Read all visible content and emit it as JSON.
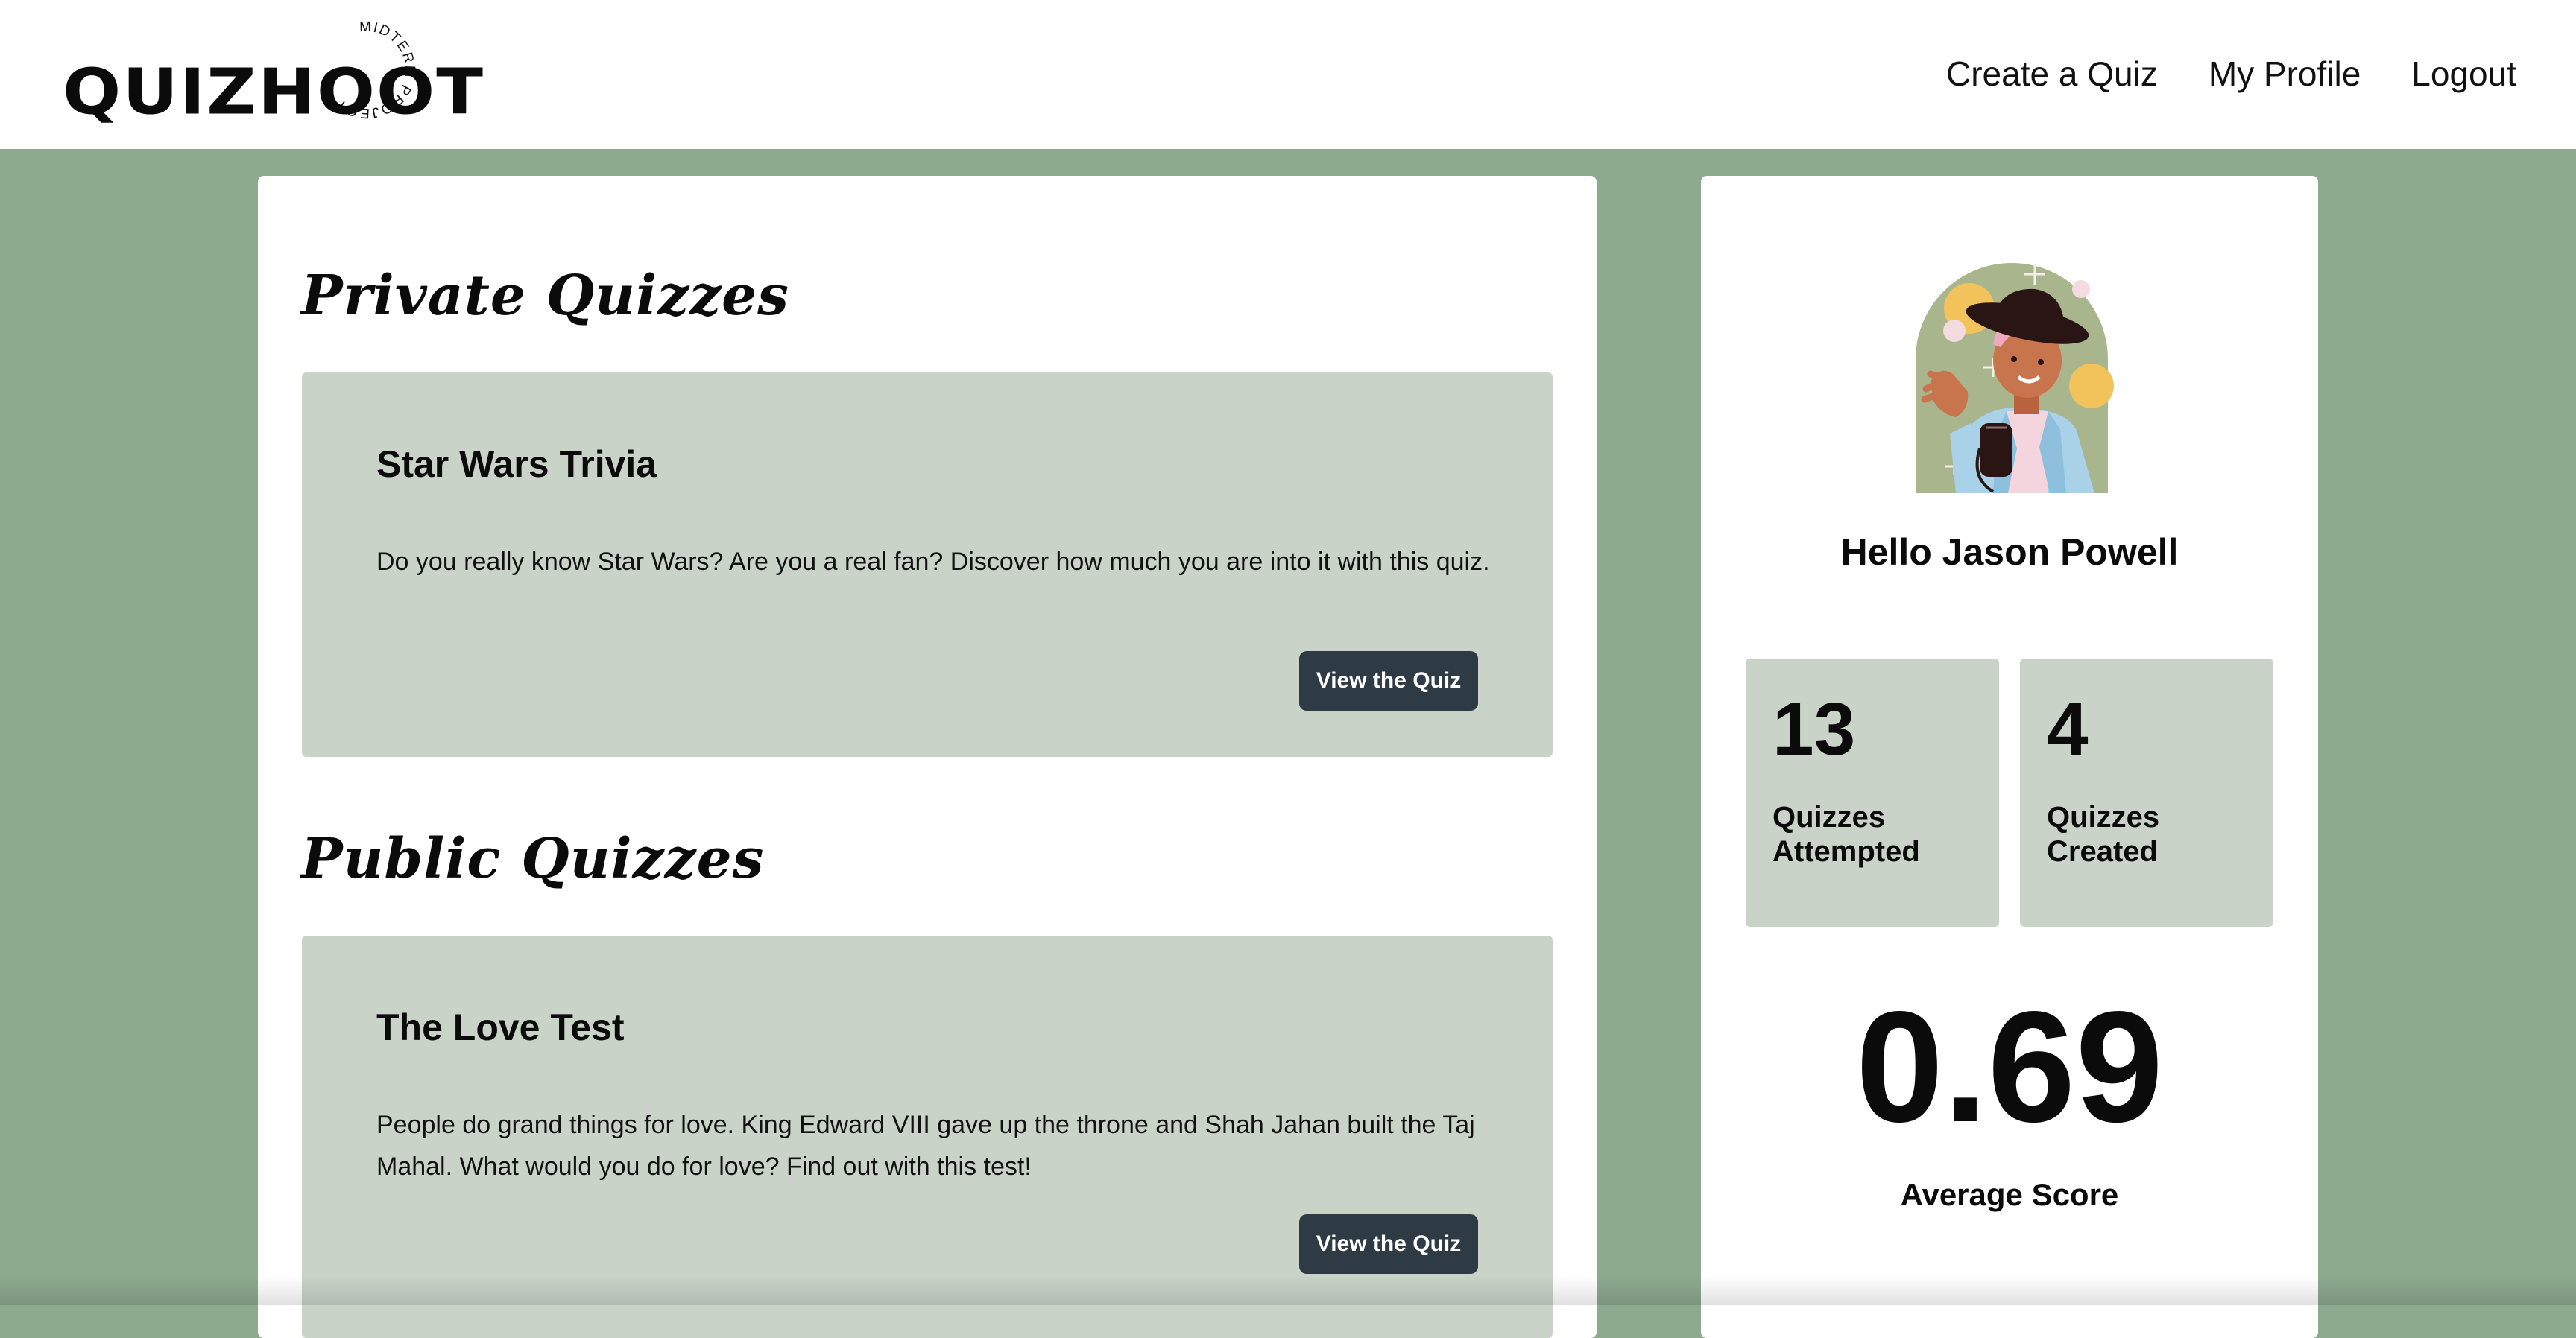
{
  "header": {
    "logo_text": "QUIZHOOT",
    "logo_ring_text": "MIDTERM PROJECT",
    "nav": {
      "create_quiz": "Create a Quiz",
      "my_profile": "My Profile",
      "logout": "Logout"
    }
  },
  "private_section": {
    "title": "Private Quizzes",
    "quizzes": [
      {
        "title": "Star Wars Trivia",
        "description": "Do you really know Star Wars? Are you a real fan? Discover how much you are into it with this quiz.",
        "button_label": "View the Quiz"
      }
    ]
  },
  "public_section": {
    "title": "Public Quizzes",
    "quizzes": [
      {
        "title": "The Love Test",
        "description": "People do grand things for love. King Edward VIII gave up the throne and Shah Jahan built the Taj Mahal. What would you do for love? Find out with this test!",
        "button_label": "View the Quiz"
      }
    ]
  },
  "profile": {
    "avatar_icon": "person-waving-avatar",
    "greeting": "Hello Jason Powell",
    "stats": [
      {
        "value": "13",
        "label": "Quizzes Attempted"
      },
      {
        "value": "4",
        "label": "Quizzes Created"
      }
    ],
    "average_score": "0.69",
    "average_label": "Average Score"
  },
  "colors": {
    "page_background": "#8daa8e",
    "card_background": "#ffffff",
    "quiz_card_background": "#c9d3c8",
    "button_background": "#2e3a44",
    "button_text": "#ffffff",
    "text": "#0b0b0b"
  }
}
